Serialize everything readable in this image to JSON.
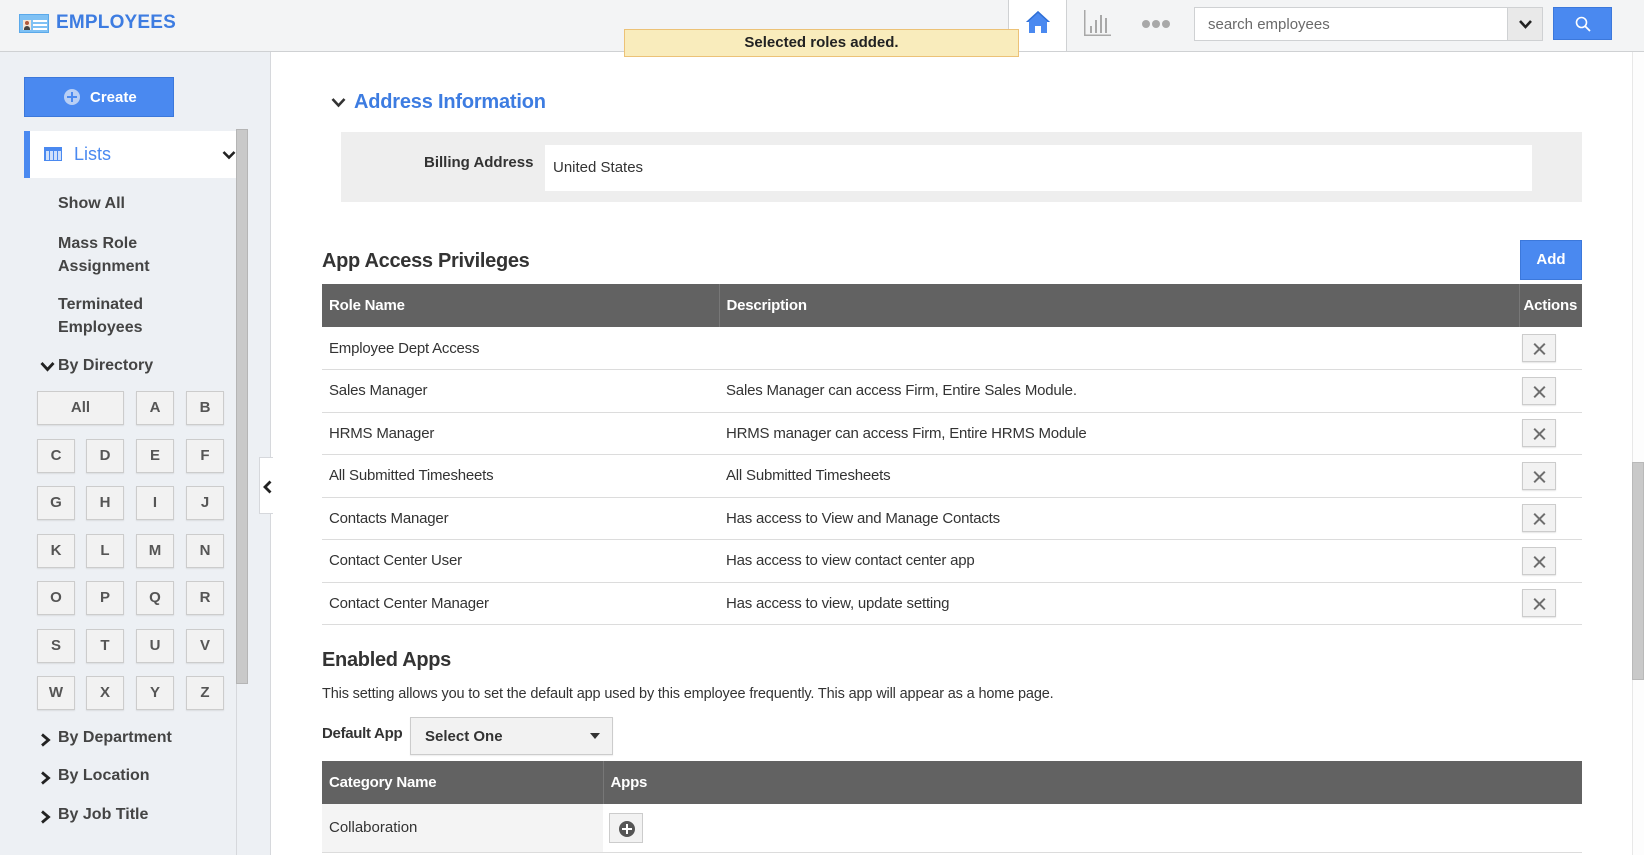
{
  "header": {
    "app_title": "EMPLOYEES",
    "toast_message": "Selected roles added.",
    "search": {
      "placeholder": "search employees",
      "value": ""
    },
    "nav_icons": [
      "home-icon",
      "chart-icon",
      "more-icon"
    ]
  },
  "sidebar": {
    "create_label": "Create",
    "lists_label": "Lists",
    "links": [
      {
        "label": "Show All"
      },
      {
        "label": "Mass Role Assignment"
      },
      {
        "label": "Terminated Employees"
      }
    ],
    "by_directory_label": "By Directory",
    "letters": [
      "All",
      "A",
      "B",
      "C",
      "D",
      "E",
      "F",
      "G",
      "H",
      "I",
      "J",
      "K",
      "L",
      "M",
      "N",
      "O",
      "P",
      "Q",
      "R",
      "S",
      "T",
      "U",
      "V",
      "W",
      "X",
      "Y",
      "Z"
    ],
    "groups": [
      {
        "label": "By Department"
      },
      {
        "label": "By Location"
      },
      {
        "label": "By Job Title"
      }
    ]
  },
  "address": {
    "section_title": "Address Information",
    "billing_label": "Billing Address",
    "billing_value": "United States"
  },
  "privileges": {
    "title": "App Access Privileges",
    "add_label": "Add",
    "columns": [
      "Role Name",
      "Description",
      "Actions"
    ],
    "rows": [
      {
        "role": "Employee Dept Access",
        "description": ""
      },
      {
        "role": "Sales Manager",
        "description": "Sales Manager can access Firm, Entire Sales Module."
      },
      {
        "role": "HRMS Manager",
        "description": "HRMS manager can access Firm, Entire HRMS Module"
      },
      {
        "role": "All Submitted Timesheets",
        "description": "All Submitted Timesheets"
      },
      {
        "role": "Contacts Manager",
        "description": "Has access to View and Manage Contacts"
      },
      {
        "role": "Contact Center User",
        "description": "Has access to view contact center app"
      },
      {
        "role": "Contact Center Manager",
        "description": "Has access to view, update setting"
      }
    ]
  },
  "enabled_apps": {
    "title": "Enabled Apps",
    "description": "This setting allows you to set the default app used by this employee frequently. This app will appear as a home page.",
    "default_app_label": "Default App",
    "default_app_value": "Select One",
    "columns": [
      "Category Name",
      "Apps"
    ],
    "rows": [
      {
        "category": "Collaboration"
      }
    ]
  },
  "colors": {
    "accent": "#4a89f0",
    "title_blue": "#3d7ce1",
    "table_header": "#626262",
    "toast_bg": "#f9ecbc"
  }
}
